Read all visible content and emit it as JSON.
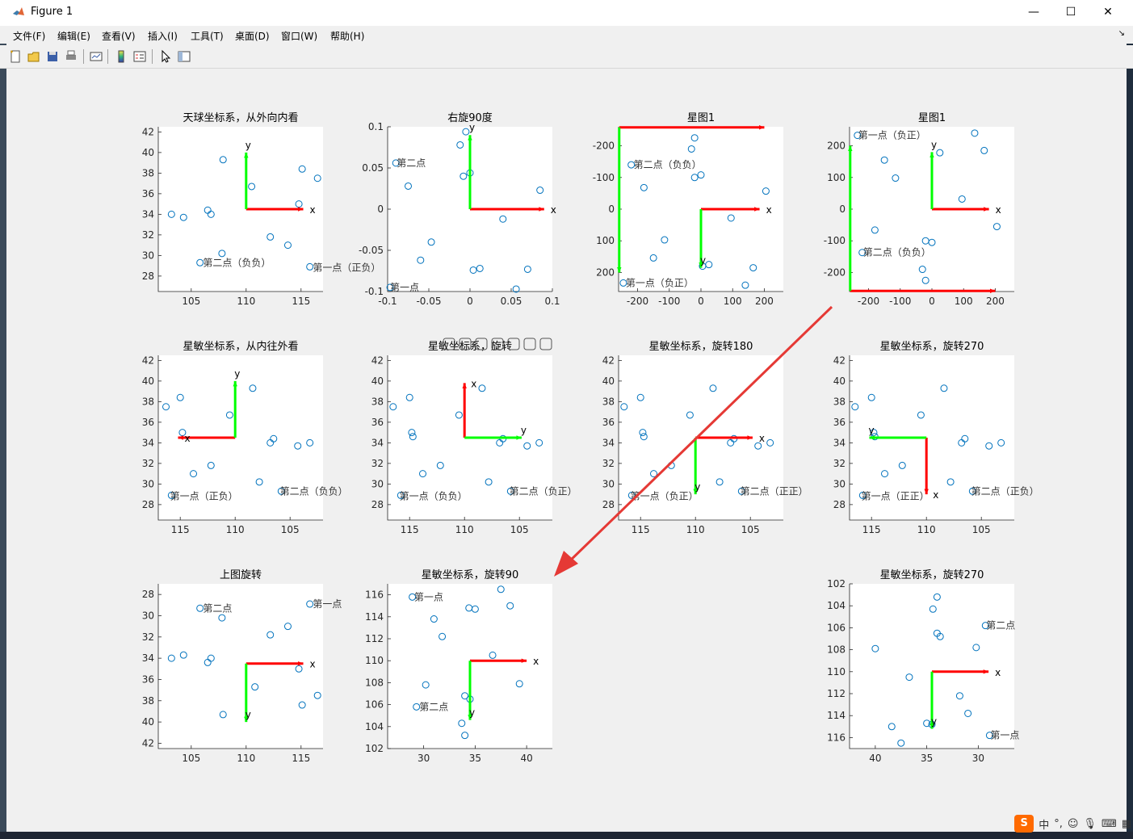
{
  "window": {
    "title": "Figure 1",
    "minimize": "—",
    "maximize": "☐",
    "close": "✕"
  },
  "menu": [
    "文件(F)",
    "编辑(E)",
    "查看(V)",
    "插入(I)",
    "工具(T)",
    "桌面(D)",
    "窗口(W)",
    "帮助(H)"
  ],
  "toolbar_icons": [
    "new-figure-icon",
    "open-file-icon",
    "save-icon",
    "print-icon",
    "link-plot-icon",
    "insert-colorbar-icon",
    "insert-legend-icon",
    "edit-plot-icon",
    "property-inspector-icon"
  ],
  "axes_toolbar_icons": [
    "brush-icon",
    "data-tips-icon",
    "restore-view-icon",
    "pan-icon",
    "zoom-in-icon",
    "zoom-out-icon",
    "home-icon"
  ],
  "tray": {
    "ime": "S",
    "lang": "中",
    "punct": "°,"
  },
  "colors": {
    "marker": "#0072bd",
    "x_axis": "#ff0000",
    "y_axis": "#00ff00",
    "arrow_overlay": "#e53935"
  },
  "subplots": [
    {
      "title": "天球坐标系，从外向内看",
      "x_ticks": [
        "105",
        "110",
        "115"
      ],
      "y_ticks": [
        "42",
        "40",
        "38",
        "36",
        "34",
        "32",
        "30",
        "28"
      ],
      "x_range": [
        102,
        117
      ],
      "y_range": [
        42.5,
        26.5
      ],
      "points": [
        [
          103.2,
          34
        ],
        [
          104.3,
          33.7
        ],
        [
          105.8,
          29.3
        ],
        [
          106.5,
          34.4
        ],
        [
          106.8,
          34
        ],
        [
          107.8,
          30.2
        ],
        [
          107.9,
          39.3
        ],
        [
          110.5,
          36.7
        ],
        [
          112.2,
          31.8
        ],
        [
          113.8,
          31
        ],
        [
          114.8,
          35
        ],
        [
          115.1,
          38.4
        ],
        [
          116.5,
          37.5
        ],
        [
          115.8,
          28.9
        ]
      ],
      "labels": [
        {
          "text": "第二点（负负）",
          "x": 106,
          "y": 29.3
        },
        {
          "text": "第一点（正负）",
          "x": 116,
          "y": 28.8
        }
      ],
      "axis_x": {
        "x1": 110,
        "y1": 34.5,
        "x2": 115.2,
        "y2": 34.5,
        "label": "x"
      },
      "axis_y": {
        "x1": 110,
        "y1": 34.5,
        "x2": 110,
        "y2": 40,
        "label": "y"
      }
    },
    {
      "title": "右旋90度",
      "x_ticks": [
        "-0.1",
        "-0.05",
        "0",
        "0.05",
        "0.1"
      ],
      "y_ticks": [
        "0.1",
        "0.05",
        "0",
        "-0.05",
        "-0.1"
      ],
      "x_range": [
        -0.1,
        0.1
      ],
      "y_range": [
        0.1,
        -0.1
      ],
      "points": [
        [
          -0.09,
          0.056
        ],
        [
          -0.075,
          0.028
        ],
        [
          -0.06,
          -0.062
        ],
        [
          -0.047,
          -0.04
        ],
        [
          -0.012,
          0.078
        ],
        [
          -0.008,
          0.04
        ],
        [
          -0.005,
          0.094
        ],
        [
          -0.0,
          0.044
        ],
        [
          0.004,
          -0.074
        ],
        [
          0.012,
          -0.072
        ],
        [
          0.04,
          -0.012
        ],
        [
          0.056,
          -0.097
        ],
        [
          0.07,
          -0.073
        ],
        [
          0.085,
          0.023
        ],
        [
          -0.097,
          -0.095
        ]
      ],
      "labels": [
        {
          "text": "第二点",
          "x": -0.09,
          "y": 0.056
        },
        {
          "text": "第一点",
          "x": -0.098,
          "y": -0.095
        }
      ],
      "axis_x": {
        "x1": 0,
        "y1": 0,
        "x2": 0.09,
        "y2": 0,
        "label": "x"
      },
      "axis_y": {
        "x1": 0,
        "y1": 0,
        "x2": 0,
        "y2": 0.09,
        "label": "y"
      }
    },
    {
      "title": "星图1",
      "x_ticks": [
        "-200",
        "-100",
        "0",
        "100",
        "200"
      ],
      "y_ticks": [
        "-200",
        "-100",
        "0",
        "100",
        "200"
      ],
      "x_range": [
        -260,
        260
      ],
      "y_range": [
        -260,
        260
      ],
      "points": [
        [
          -220,
          -140
        ],
        [
          -180,
          -68
        ],
        [
          -150,
          154
        ],
        [
          -115,
          97
        ],
        [
          -30,
          -190
        ],
        [
          -20,
          -225
        ],
        [
          -20,
          -100
        ],
        [
          0,
          -108
        ],
        [
          5,
          180
        ],
        [
          25,
          175
        ],
        [
          95,
          28
        ],
        [
          165,
          185
        ],
        [
          205,
          -57
        ],
        [
          140,
          240
        ],
        [
          -245,
          233
        ]
      ],
      "labels": [
        {
          "text": "第二点（负负）",
          "x": -215,
          "y": -140
        },
        {
          "text": "第一点（负正）",
          "x": -240,
          "y": 233
        }
      ],
      "axis_x": {
        "x1": 0,
        "y1": 0,
        "x2": 185,
        "y2": 0,
        "label": "x"
      },
      "axis_y": {
        "x1": 0,
        "y1": 0,
        "x2": 0,
        "y2": 185,
        "label": "y"
      },
      "frame_x": {
        "x1": -258,
        "y1": -258,
        "x2": 200,
        "y2": -258
      },
      "frame_y": {
        "x1": -258,
        "y1": -258,
        "x2": -258,
        "y2": 200
      }
    },
    {
      "title": "星图1",
      "x_ticks": [
        "-200",
        "-100",
        "0",
        "100",
        "200"
      ],
      "y_ticks": [
        "200",
        "100",
        "0",
        "-100",
        "-200"
      ],
      "x_range": [
        -260,
        260
      ],
      "y_range": [
        260,
        -260
      ],
      "points": [
        [
          -235,
          233
        ],
        [
          -150,
          155
        ],
        [
          -115,
          98
        ],
        [
          -180,
          -66
        ],
        [
          -220,
          -137
        ],
        [
          -30,
          -190
        ],
        [
          -20,
          -225
        ],
        [
          -20,
          -100
        ],
        [
          0,
          -105
        ],
        [
          25,
          178
        ],
        [
          95,
          32
        ],
        [
          165,
          185
        ],
        [
          205,
          -55
        ],
        [
          135,
          240
        ]
      ],
      "labels": [
        {
          "text": "第一点（负正）",
          "x": -235,
          "y": 233
        },
        {
          "text": "第二点（负负）",
          "x": -220,
          "y": -137
        }
      ],
      "axis_x": {
        "x1": 0,
        "y1": 0,
        "x2": 180,
        "y2": 0,
        "label": "x"
      },
      "axis_y": {
        "x1": 0,
        "y1": 0,
        "x2": 0,
        "y2": 180,
        "label": "y"
      },
      "frame_x": {
        "x1": -258,
        "y1": -258,
        "x2": 200,
        "y2": -258
      },
      "frame_y": {
        "x1": -258,
        "y1": -258,
        "x2": -258,
        "y2": 200
      }
    },
    {
      "title": "星敏坐标系，从内往外看",
      "x_ticks": [
        "115",
        "110",
        "105"
      ],
      "y_ticks": [
        "42",
        "40",
        "38",
        "36",
        "34",
        "32",
        "30",
        "28"
      ],
      "x_range": [
        117,
        102
      ],
      "y_range": [
        42.5,
        26.5
      ],
      "points": [
        [
          116.3,
          37.5
        ],
        [
          115,
          38.4
        ],
        [
          114.8,
          35
        ],
        [
          113.8,
          31
        ],
        [
          112.2,
          31.8
        ],
        [
          110.5,
          36.7
        ],
        [
          108.4,
          39.3
        ],
        [
          107.8,
          30.2
        ],
        [
          106.8,
          34
        ],
        [
          106.5,
          34.4
        ],
        [
          104.3,
          33.7
        ],
        [
          103.2,
          34
        ],
        [
          115.8,
          28.9
        ],
        [
          105.8,
          29.3
        ]
      ],
      "labels": [
        {
          "text": "第一点（正负）",
          "x": 116,
          "y": 28.8
        },
        {
          "text": "第二点（负负）",
          "x": 106,
          "y": 29.3
        }
      ],
      "axis_x": {
        "x1": 110,
        "y1": 34.5,
        "x2": 115.2,
        "y2": 34.5,
        "label": "x"
      },
      "axis_y": {
        "x1": 110,
        "y1": 34.5,
        "x2": 110,
        "y2": 40,
        "label": "y"
      }
    },
    {
      "title": "星敏坐标系，旋转",
      "x_ticks": [
        "115",
        "110",
        "105"
      ],
      "y_ticks": [
        "42",
        "40",
        "38",
        "36",
        "34",
        "32",
        "30",
        "28"
      ],
      "x_range": [
        117,
        102
      ],
      "y_range": [
        42.5,
        26.5
      ],
      "points": [
        [
          116.5,
          37.5
        ],
        [
          115,
          38.4
        ],
        [
          114.8,
          35
        ],
        [
          114.7,
          34.6
        ],
        [
          113.8,
          31
        ],
        [
          112.2,
          31.8
        ],
        [
          110.5,
          36.7
        ],
        [
          108.4,
          39.3
        ],
        [
          107.8,
          30.2
        ],
        [
          106.8,
          34
        ],
        [
          106.5,
          34.4
        ],
        [
          104.3,
          33.7
        ],
        [
          103.2,
          34
        ],
        [
          115.8,
          28.9
        ],
        [
          105.8,
          29.3
        ]
      ],
      "labels": [
        {
          "text": "第一点（负负）",
          "x": 116,
          "y": 28.8
        },
        {
          "text": "第二点（负正）",
          "x": 106,
          "y": 29.3
        }
      ],
      "axis_x": {
        "x1": 110,
        "y1": 34.5,
        "x2": 110,
        "y2": 39.8,
        "label": "x"
      },
      "axis_y": {
        "x1": 110,
        "y1": 34.5,
        "x2": 104.8,
        "y2": 34.5,
        "label": "y"
      }
    },
    {
      "title": "星敏坐标系，旋转180",
      "x_ticks": [
        "115",
        "110",
        "105"
      ],
      "y_ticks": [
        "42",
        "40",
        "38",
        "36",
        "34",
        "32",
        "30",
        "28"
      ],
      "x_range": [
        117,
        102
      ],
      "y_range": [
        42.5,
        26.5
      ],
      "points": [
        [
          116.5,
          37.5
        ],
        [
          115,
          38.4
        ],
        [
          114.8,
          35
        ],
        [
          114.7,
          34.6
        ],
        [
          113.8,
          31
        ],
        [
          112.2,
          31.8
        ],
        [
          110.5,
          36.7
        ],
        [
          108.4,
          39.3
        ],
        [
          107.8,
          30.2
        ],
        [
          106.8,
          34
        ],
        [
          106.5,
          34.4
        ],
        [
          104.3,
          33.7
        ],
        [
          103.2,
          34
        ],
        [
          115.8,
          28.9
        ],
        [
          105.8,
          29.3
        ]
      ],
      "labels": [
        {
          "text": "第一点（负正）",
          "x": 116,
          "y": 28.8
        },
        {
          "text": "第二点（正正）",
          "x": 106,
          "y": 29.3
        }
      ],
      "axis_x": {
        "x1": 110,
        "y1": 34.5,
        "x2": 104.8,
        "y2": 34.5,
        "label": "x"
      },
      "axis_y": {
        "x1": 110,
        "y1": 34.5,
        "x2": 110,
        "y2": 29,
        "label": "y"
      }
    },
    {
      "title": "星敏坐标系，旋转270",
      "x_ticks": [
        "115",
        "110",
        "105"
      ],
      "y_ticks": [
        "42",
        "40",
        "38",
        "36",
        "34",
        "32",
        "30",
        "28"
      ],
      "x_range": [
        117,
        102
      ],
      "y_range": [
        42.5,
        26.5
      ],
      "points": [
        [
          116.5,
          37.5
        ],
        [
          115,
          38.4
        ],
        [
          114.8,
          35
        ],
        [
          114.7,
          34.6
        ],
        [
          113.8,
          31
        ],
        [
          112.2,
          31.8
        ],
        [
          110.5,
          36.7
        ],
        [
          108.4,
          39.3
        ],
        [
          107.8,
          30.2
        ],
        [
          106.8,
          34
        ],
        [
          106.5,
          34.4
        ],
        [
          104.3,
          33.7
        ],
        [
          103.2,
          34
        ],
        [
          115.8,
          28.9
        ],
        [
          105.8,
          29.3
        ]
      ],
      "labels": [
        {
          "text": "第一点（正正）",
          "x": 116,
          "y": 28.8
        },
        {
          "text": "第二点（正负）",
          "x": 106,
          "y": 29.3
        }
      ],
      "axis_x": {
        "x1": 110,
        "y1": 34.5,
        "x2": 110,
        "y2": 29,
        "label": "x"
      },
      "axis_y": {
        "x1": 110,
        "y1": 34.5,
        "x2": 115.2,
        "y2": 34.5,
        "label": "y"
      }
    },
    {
      "title": "上图旋转",
      "x_ticks": [
        "105",
        "110",
        "115"
      ],
      "y_ticks": [
        "28",
        "30",
        "32",
        "34",
        "36",
        "38",
        "40",
        "42"
      ],
      "x_range": [
        102,
        117
      ],
      "y_range": [
        27,
        42.5
      ],
      "points": [
        [
          103.2,
          34
        ],
        [
          104.3,
          33.7
        ],
        [
          105.8,
          29.3
        ],
        [
          106.5,
          34.4
        ],
        [
          106.8,
          34
        ],
        [
          107.8,
          30.2
        ],
        [
          107.9,
          39.3
        ],
        [
          110.8,
          36.7
        ],
        [
          112.2,
          31.8
        ],
        [
          113.8,
          31
        ],
        [
          114.8,
          35
        ],
        [
          115.1,
          38.4
        ],
        [
          116.5,
          37.5
        ],
        [
          115.8,
          28.9
        ]
      ],
      "labels": [
        {
          "text": "第二点",
          "x": 106,
          "y": 29.3
        },
        {
          "text": "第一点",
          "x": 116,
          "y": 28.9
        }
      ],
      "axis_x": {
        "x1": 110,
        "y1": 34.5,
        "x2": 115.2,
        "y2": 34.5,
        "label": "x"
      },
      "axis_y": {
        "x1": 110,
        "y1": 34.5,
        "x2": 110,
        "y2": 40,
        "label": "y"
      }
    },
    {
      "title": "星敏坐标系，旋转90",
      "x_ticks": [
        "30",
        "35",
        "40"
      ],
      "y_ticks": [
        "116",
        "114",
        "112",
        "110",
        "108",
        "106",
        "104",
        "102"
      ],
      "x_range": [
        26.5,
        42.5
      ],
      "y_range": [
        117,
        102
      ],
      "points": [
        [
          28.9,
          115.8
        ],
        [
          30.2,
          107.8
        ],
        [
          31,
          113.8
        ],
        [
          31.8,
          112.2
        ],
        [
          33.7,
          104.3
        ],
        [
          34,
          106.8
        ],
        [
          34.4,
          114.8
        ],
        [
          34.5,
          106.5
        ],
        [
          35,
          114.7
        ],
        [
          36.7,
          110.5
        ],
        [
          37.5,
          116.5
        ],
        [
          38.4,
          115
        ],
        [
          39.3,
          107.9
        ],
        [
          29.3,
          105.8
        ],
        [
          34,
          103.2
        ]
      ],
      "labels": [
        {
          "text": "第一点",
          "x": 29,
          "y": 115.8
        },
        {
          "text": "第二点",
          "x": 29.5,
          "y": 105.8
        }
      ],
      "axis_x": {
        "x1": 34.5,
        "y1": 110,
        "x2": 40,
        "y2": 110,
        "label": "x"
      },
      "axis_y": {
        "x1": 34.5,
        "y1": 110,
        "x2": 34.5,
        "y2": 104.6,
        "label": "y"
      }
    },
    {
      "title": "星敏坐标系，旋转270",
      "x_ticks": [
        "40",
        "35",
        "30"
      ],
      "y_ticks": [
        "102",
        "104",
        "106",
        "108",
        "110",
        "112",
        "114",
        "116"
      ],
      "x_range": [
        42.5,
        26.5
      ],
      "y_range": [
        102,
        117
      ],
      "points": [
        [
          40,
          107.9
        ],
        [
          38.4,
          115
        ],
        [
          37.5,
          116.5
        ],
        [
          36.7,
          110.5
        ],
        [
          35,
          114.7
        ],
        [
          34.5,
          114.8
        ],
        [
          34,
          106.5
        ],
        [
          33.7,
          106.8
        ],
        [
          34.4,
          104.3
        ],
        [
          34,
          103.2
        ],
        [
          31.8,
          112.2
        ],
        [
          31,
          113.8
        ],
        [
          30.2,
          107.8
        ],
        [
          29.3,
          105.8
        ],
        [
          28.9,
          115.8
        ]
      ],
      "labels": [
        {
          "text": "第二点",
          "x": 29.3,
          "y": 105.8
        },
        {
          "text": "第一点",
          "x": 28.9,
          "y": 115.8
        }
      ],
      "axis_x": {
        "x1": 34.5,
        "y1": 110,
        "x2": 29,
        "y2": 110,
        "label": "x"
      },
      "axis_y": {
        "x1": 34.5,
        "y1": 110,
        "x2": 34.5,
        "y2": 115.2,
        "label": "y"
      }
    }
  ]
}
